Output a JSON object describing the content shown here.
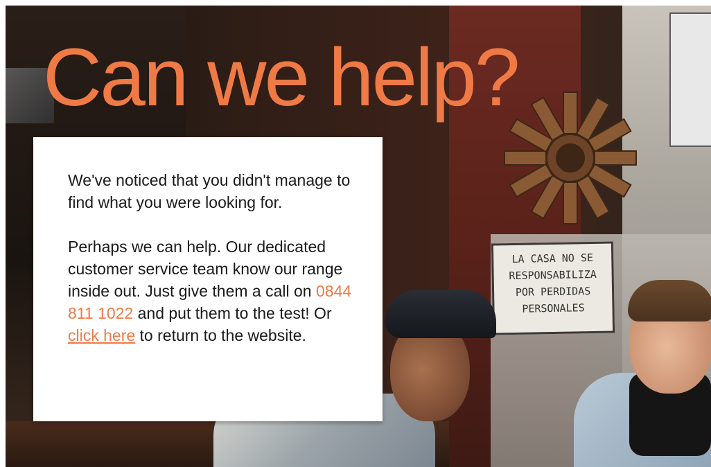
{
  "headline": "Can we help?",
  "message": {
    "paragraph1": "We've noticed that you didn't manage to find what you were looking for.",
    "paragraph2_part1": "Perhaps we can help. Our dedicated customer service team know our range inside out. Just give them a call on ",
    "phone": "0844 811 1022",
    "paragraph2_part2": " and put them to the test! Or ",
    "link_text": "click here",
    "paragraph2_part3": " to return to the website."
  },
  "sign": {
    "lines": [
      "LA CASA NO SE",
      "RESPONSABILIZA",
      "POR PERDIDAS",
      "PERSONALES"
    ]
  },
  "colors": {
    "accent": "#f07a45",
    "card_background": "#ffffff",
    "text": "#1a1a1a"
  }
}
